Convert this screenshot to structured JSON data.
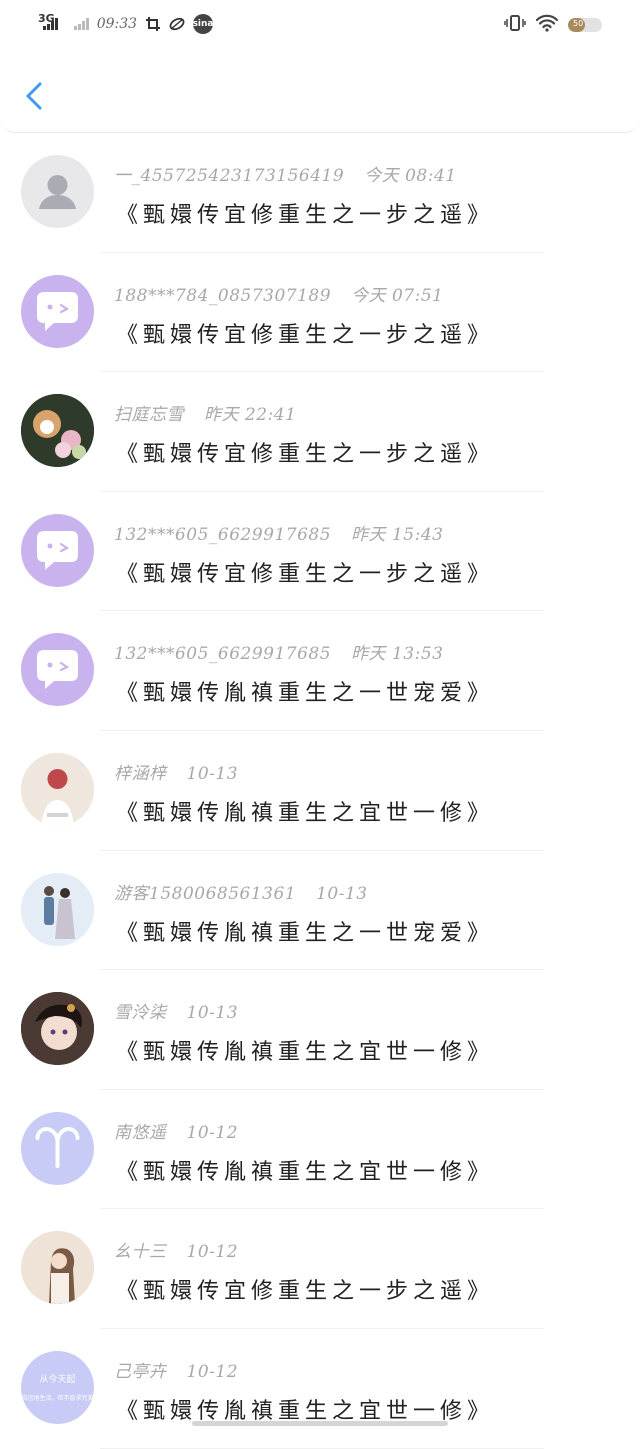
{
  "status_bar": {
    "network": "3G",
    "time": "09:33",
    "icon_sina": "sina",
    "battery_level": 0.5,
    "battery_text": "50",
    "colors": {
      "battery_fill": "#a98a5a"
    }
  },
  "header": {
    "back_icon": "chevron-left-icon",
    "accent": "#3b9bf0"
  },
  "items": [
    {
      "username": "一_455725423173156419",
      "time": "今天 08:41",
      "title": "《甄嬛传宜修重生之一步之遥》",
      "avatar": "default-person"
    },
    {
      "username": "188***784_0857307189",
      "time": "今天 07:51",
      "title": "《甄嬛传宜修重生之一步之遥》",
      "avatar": "chat-bubble"
    },
    {
      "username": "扫庭忘雪",
      "time": "昨天 22:41",
      "title": "《甄嬛传宜修重生之一步之遥》",
      "avatar": "dog-photo"
    },
    {
      "username": "132***605_6629917685",
      "time": "昨天 15:43",
      "title": "《甄嬛传宜修重生之一步之遥》",
      "avatar": "chat-bubble"
    },
    {
      "username": "132***605_6629917685",
      "time": "昨天 13:53",
      "title": "《甄嬛传胤禛重生之一世宠爱》",
      "avatar": "chat-bubble"
    },
    {
      "username": "梓涵梓",
      "time": "10-13",
      "title": "《甄嬛传胤禛重生之宜世一修》",
      "avatar": "girl-photo"
    },
    {
      "username": "游客1580068561361",
      "time": "10-13",
      "title": "《甄嬛传胤禛重生之一世宠爱》",
      "avatar": "couple-photo"
    },
    {
      "username": "雪泠柒",
      "time": "10-13",
      "title": "《甄嬛传胤禛重生之宜世一修》",
      "avatar": "anime-photo"
    },
    {
      "username": "南悠遥",
      "time": "10-12",
      "title": "《甄嬛传胤禛重生之宜世一修》",
      "avatar": "aries-sign"
    },
    {
      "username": "幺十三",
      "time": "10-12",
      "title": "《甄嬛传宜修重生之一步之遥》",
      "avatar": "woman-photo"
    },
    {
      "username": "己亭卉",
      "time": "10-12",
      "title": "《甄嬛传胤禛重生之宜世一修》",
      "avatar": "text-card",
      "avatar_text": [
        "从今天起",
        "自信地生活，但不盲求完美"
      ]
    }
  ]
}
